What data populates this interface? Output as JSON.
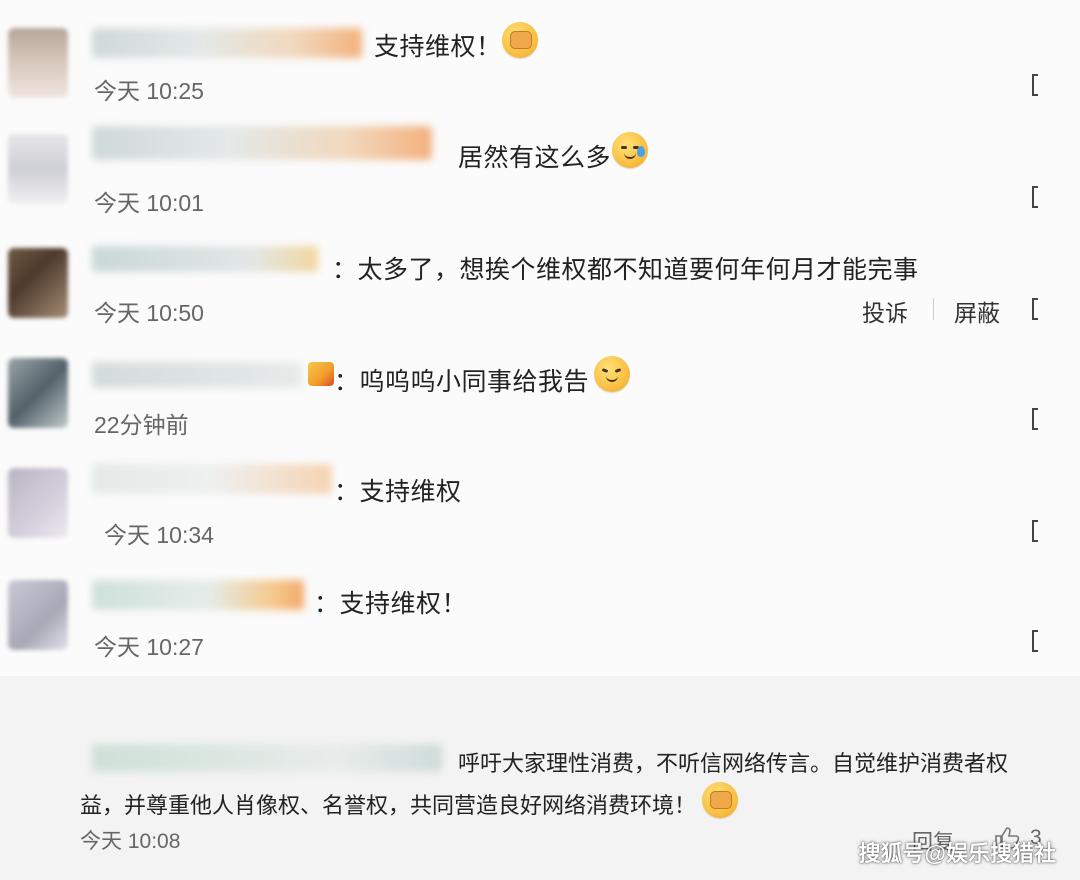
{
  "comments": [
    {
      "text": "支持维权！",
      "time": "今天 10:25"
    },
    {
      "text": "居然有这么多",
      "time": "今天 10:01"
    },
    {
      "text": "：太多了，想挨个维权都不知道要何年何月才能完事",
      "time": "今天 10:50",
      "actions": {
        "report": "投诉",
        "block": "屏蔽"
      }
    },
    {
      "text": "：呜呜呜小同事给我告",
      "time": "22分钟前"
    },
    {
      "text": "：支持维权",
      "time": "今天 10:34"
    },
    {
      "text": "：支持维权！",
      "time": "今天 10:27"
    }
  ],
  "bottom_comment": {
    "line1": "呼吁大家理性消费，不听信网络传言。自觉维护消费者权",
    "line2": "益，并尊重他人肖像权、名誉权，共同营造良好网络消费环境！",
    "time": "今天 10:08",
    "reply_label": "回复",
    "like_count": "3"
  },
  "watermark": "搜狐号@娱乐搜猎社",
  "icons": {
    "emoji_fist": "fist-emoji-icon",
    "emoji_sweat": "sweat-face-emoji-icon",
    "emoji_dizzy": "dizzy-face-emoji-icon",
    "like": "thumbs-up-icon"
  },
  "colors": {
    "text": "#222222",
    "meta": "#666666",
    "divider": "#e6e6e6"
  }
}
